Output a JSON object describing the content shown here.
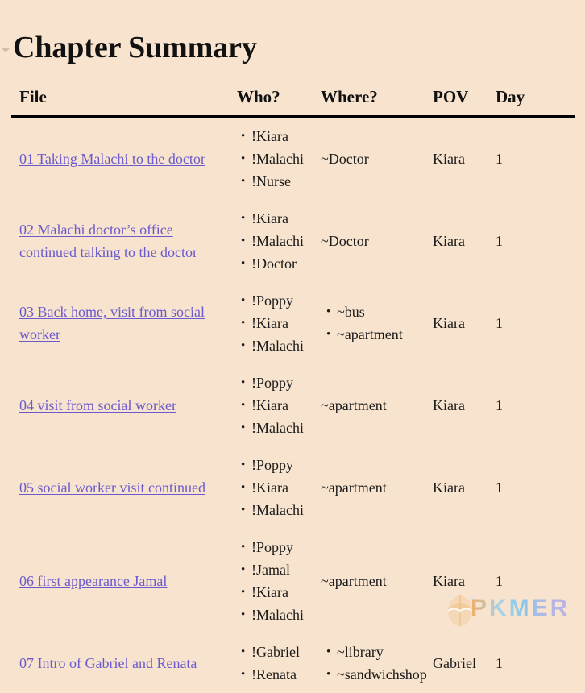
{
  "document": {
    "title": "Chapter Summary",
    "fold_icon": "chevron-down-icon",
    "background_color": "#f8e4ce",
    "link_color": "#6a5acd",
    "rule_color": "#000000"
  },
  "table": {
    "columns": [
      {
        "key": "file",
        "label": "File"
      },
      {
        "key": "who",
        "label": "Who?"
      },
      {
        "key": "where",
        "label": "Where?"
      },
      {
        "key": "pov",
        "label": "POV"
      },
      {
        "key": "day",
        "label": "Day"
      }
    ],
    "rows": [
      {
        "file": "01 Taking Malachi to the doctor",
        "who": [
          "!Kiara",
          "!Malachi",
          "!Nurse"
        ],
        "where": [
          "~Doctor"
        ],
        "where_bulleted": false,
        "pov": "Kiara",
        "day": "1"
      },
      {
        "file": "02 Malachi doctor’s office continued talking to the doctor",
        "who": [
          "!Kiara",
          "!Malachi",
          "!Doctor"
        ],
        "where": [
          "~Doctor"
        ],
        "where_bulleted": false,
        "pov": "Kiara",
        "day": "1"
      },
      {
        "file": "03 Back home, visit from social worker",
        "who": [
          "!Poppy",
          "!Kiara",
          "!Malachi"
        ],
        "where": [
          "~bus",
          "~apartment"
        ],
        "where_bulleted": true,
        "pov": "Kiara",
        "day": "1"
      },
      {
        "file": "04 visit from social worker",
        "who": [
          "!Poppy",
          "!Kiara",
          "!Malachi"
        ],
        "where": [
          "~apartment"
        ],
        "where_bulleted": false,
        "pov": "Kiara",
        "day": "1"
      },
      {
        "file": "05 social worker visit continued",
        "who": [
          "!Poppy",
          "!Kiara",
          "!Malachi"
        ],
        "where": [
          "~apartment"
        ],
        "where_bulleted": false,
        "pov": "Kiara",
        "day": "1"
      },
      {
        "file": "06 first appearance Jamal",
        "who": [
          "!Poppy",
          "!Jamal",
          "!Kiara",
          "!Malachi"
        ],
        "where": [
          "~apartment"
        ],
        "where_bulleted": false,
        "pov": "Kiara",
        "day": "1"
      },
      {
        "file": "07 Intro of Gabriel and Renata",
        "who": [
          "!Gabriel",
          "!Renata"
        ],
        "where": [
          "~library",
          "~sandwichshop"
        ],
        "where_bulleted": true,
        "pov": "Gabriel",
        "day": "1"
      }
    ]
  },
  "watermark": {
    "text": "PKMER",
    "logo_icon": "egg-logo-icon"
  }
}
